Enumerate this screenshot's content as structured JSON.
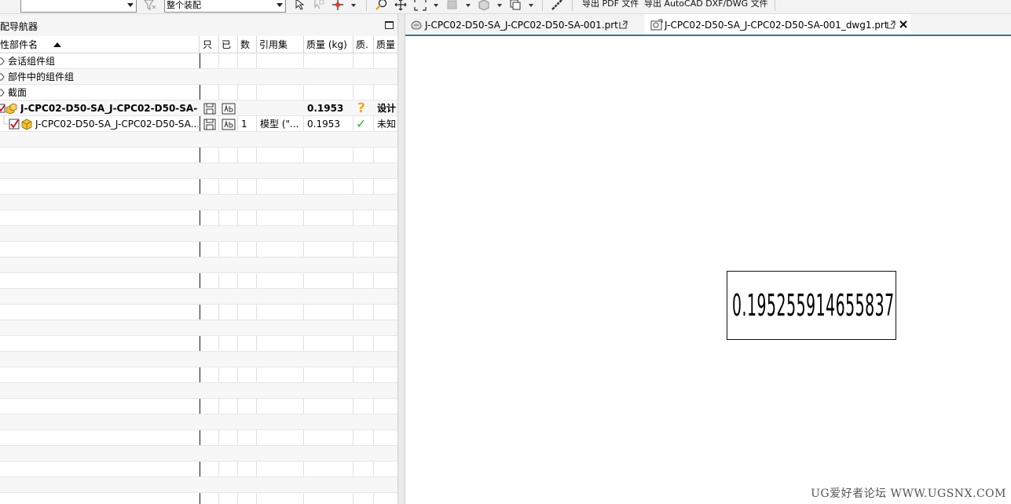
{
  "toolbar": {
    "filter_value": "",
    "scope_value": "整个装配",
    "export_pdf_label": "导出 PDF 文件",
    "export_dxf_label": "导出 AutoCAD DXF/DWG 文件"
  },
  "navigator": {
    "title": "配导航器",
    "columns": {
      "name": "性部件名",
      "readonly": "只",
      "modified": "已",
      "count": "数",
      "refset": "引用集",
      "mass": "质量 (kg)",
      "quality": "质.",
      "mass_state": "质量"
    },
    "groups": [
      {
        "label": "会话组件组"
      },
      {
        "label": "部件中的组件组"
      },
      {
        "label": "截面"
      }
    ],
    "rows": [
      {
        "name": "J-CPC02-D50-SA_J-CPC02-D50-SA-0...",
        "count": "",
        "refset": "",
        "mass": "0.1953",
        "quality": "?",
        "mass_state": "设计"
      },
      {
        "name": "J-CPC02-D50-SA_J-CPC02-D50-SA...",
        "count": "1",
        "refset": "模型 (\"...",
        "mass": "0.1953",
        "quality": "✓",
        "mass_state": "未知"
      }
    ]
  },
  "tabs": [
    {
      "label": "J-CPC02-D50-SA_J-CPC02-D50-SA-001.prt"
    },
    {
      "label": "J-CPC02-D50-SA_J-CPC02-D50-SA-001_dwg1.prt"
    }
  ],
  "drawing": {
    "mass_note": "0.195255914655837"
  },
  "watermark": "UG爱好者论坛 WWW.UGSNX.COM",
  "colors": {
    "accent": "#2f7a8f",
    "check_green": "#2fb52f",
    "question_orange": "#f0a81a",
    "checkbox_red": "#c8001a"
  }
}
